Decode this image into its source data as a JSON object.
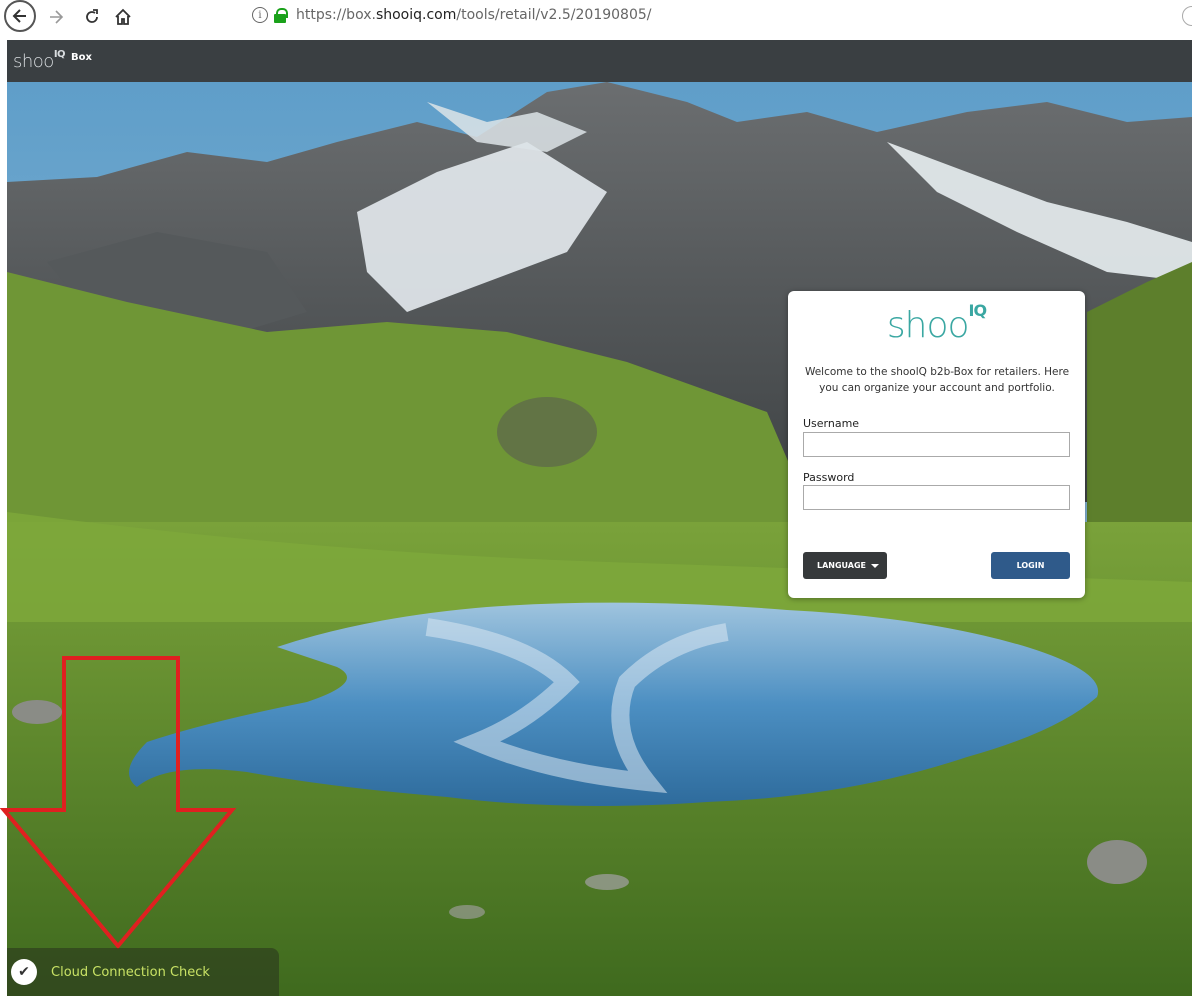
{
  "browser": {
    "url_prefix": "https://box.",
    "url_domain": "shooiq.com",
    "url_path": "/tools/retail/v2.5/20190805/",
    "back_icon": "back-arrow-icon",
    "forward_icon": "forward-arrow-icon",
    "reload_icon": "reload-icon",
    "home_icon": "home-icon"
  },
  "header": {
    "logo": "shoo",
    "logo_sup": "IQ",
    "product": "Box"
  },
  "login": {
    "logo": "shoo",
    "logo_sup": "IQ",
    "welcome": "Welcome to the shoolQ b2b-Box for retailers. Here you can organize your account and portfolio.",
    "username_label": "Username",
    "username_value": "",
    "password_label": "Password",
    "password_value": "",
    "language_label": "LANGUAGE",
    "login_label": "LOGIN"
  },
  "footer": {
    "cloud_check_label": "Cloud Connection Check"
  },
  "colors": {
    "header_bg": "#3a3f42",
    "brand_teal": "#3aa7a2",
    "login_button": "#2f5a8a",
    "language_button": "#36393b",
    "cloud_text": "#c9e265",
    "annotation_red": "#e02020"
  }
}
